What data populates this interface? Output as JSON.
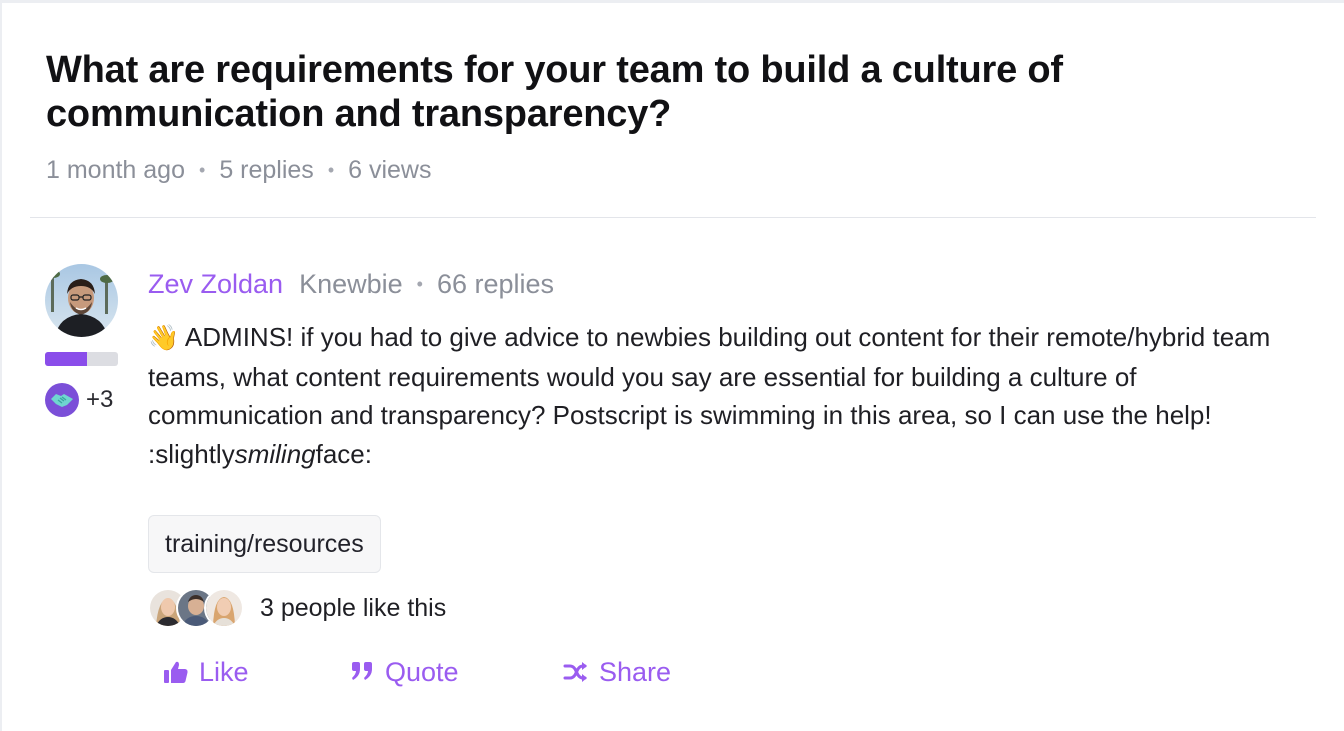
{
  "thread": {
    "title": "What are requirements for your team to build a culture of communication and transparency?",
    "age": "1 month ago",
    "replies": "5 replies",
    "views": "6 views"
  },
  "post": {
    "author": {
      "name": "Zev Zoldan",
      "rank": "Knewbie",
      "replies": "66 replies",
      "level_fraction": 0.58,
      "badge_extra": "+3"
    },
    "body": {
      "emoji": "👋",
      "text": " ADMINS! if you had to give advice to newbies building out content for their remote/hybrid team teams, what content requirements would you say are essential for building a culture of communication and transparency? Postscript is swimming in this area, so I can use the help! :slightly",
      "emphasis": "smiling",
      "tail": "face:"
    },
    "tag": "training/resources",
    "likes_text": "3 people like this",
    "actions": {
      "like": "Like",
      "quote": "Quote",
      "share": "Share"
    }
  },
  "colors": {
    "accent": "#9a5cf0",
    "badge": "#7b4fd8",
    "muted": "#8b8f99"
  },
  "icons": [
    "thumbs-up-icon",
    "quote-icon",
    "shuffle-icon",
    "handshake-badge-icon"
  ]
}
